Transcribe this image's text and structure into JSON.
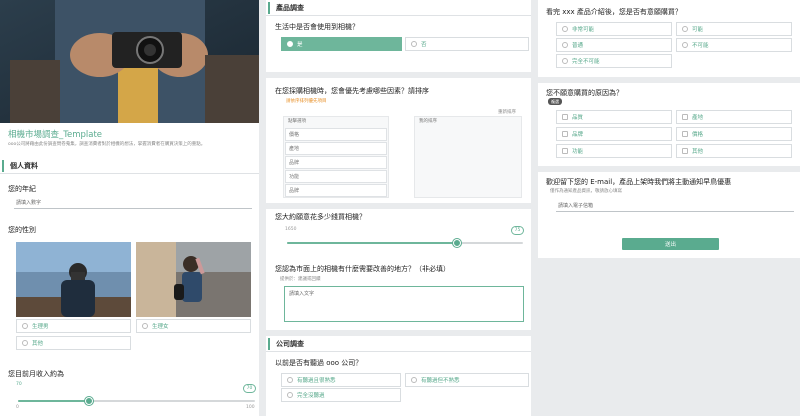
{
  "colors": {
    "accent": "#5aab8f",
    "accent_light": "#6eb69b",
    "orange": "#e8922c"
  },
  "col1": {
    "hero_icon": "camera-hands-photo",
    "title": "相機市場調查_Template",
    "description": "ooo公司將藉由此份調查問卷蒐集，調查消費者對於相機的想法，掌握消費者在購買決策上的重點。",
    "section1": "個人資料",
    "age_q": "您的年紀",
    "age_placeholder": "請填入數字",
    "gender_q": "您的性別",
    "gender_options": [
      "生理男",
      "生理女"
    ],
    "gender_other": "其他",
    "income_q": "您目前月收入約為",
    "income_value": "70",
    "income_fraction": 0.3,
    "income_min": "0",
    "income_max": "100"
  },
  "col2": {
    "section": "產品調查",
    "q1": "生活中是否會使用到相機？",
    "q1_yes": "是",
    "q1_no": "否",
    "q2": "在您採購相機時，您會優先考慮哪些因素？請排序",
    "q2_sub": "請依序排列優先項目",
    "rank_left_header": "點擊選項",
    "rank_right_header": "我的排序",
    "rank_reset": "重新排序",
    "rank_items": [
      "價格",
      "產地",
      "品牌",
      "功能",
      "品牌"
    ],
    "q3": "您大約願意花多少錢買相機？",
    "q3_min": "1650",
    "q3_value": "75",
    "q3_fraction": 0.72,
    "q4": "您認為市面上的相機有什麼需要改善的地方？（非必填）",
    "q4_sub": "提供於：建議或回饋",
    "q4_placeholder": "請填入文字",
    "section2": "公司調查",
    "q5": "以前是否有聽過 ooo 公司？",
    "q5_options": [
      "有聽過且很熟悉",
      "有聽過但不熟悉",
      "完全沒聽過"
    ]
  },
  "col3": {
    "q1": "看完 xxx 產品介紹後，您是否有意願購買？",
    "q1_options": [
      "非常可能",
      "可能",
      "普通",
      "不可能",
      "完全不可能"
    ],
    "q2": "您不願意購買的原因為？",
    "q2_tag": "複選",
    "q2_options": [
      "品質",
      "產地",
      "品牌",
      "價格",
      "功能",
      "其他"
    ],
    "q3": "歡迎留下您的 E-mail，產品上架時我們將主動通知早鳥優惠",
    "q3_sub": "僅作為通知產品資訊，敬請放心填寫",
    "q3_placeholder": "請填入電子信箱",
    "submit": "送出"
  }
}
